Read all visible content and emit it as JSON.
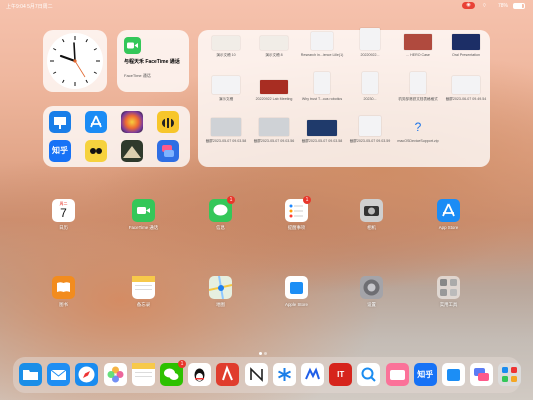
{
  "status": {
    "time_date": "上午9:04  5月7日周二",
    "battery": "78%",
    "battery_level": 0.78,
    "rec_color": "#e94235"
  },
  "facetime_widget": {
    "name": "与程天禾 FaceTime 通话",
    "subtitle": "FaceTime 通话"
  },
  "files_widget": {
    "items": [
      {
        "label": "演示文稿 10",
        "thumb": "#f1ede7"
      },
      {
        "label": "演示文稿 8",
        "thumb": "#f1ede7"
      },
      {
        "label": "Research in...ience Lille(1)",
        "thumb": "#f3f3f5"
      },
      {
        "label": "20220922...",
        "thumb": "#f3f3f5"
      },
      {
        "label": "... HERO Case",
        "thumb": "#b04a3e"
      },
      {
        "label": "Oral Presentation",
        "thumb": "#1c2e66"
      },
      {
        "label": "演示文稿",
        "thumb": "#f3f3f5"
      },
      {
        "label": "20220922 Lab Meeting",
        "thumb": "#a82d22"
      },
      {
        "label": "Why trust T...ous robotics",
        "thumb": "#f3f3f5"
      },
      {
        "label": "20230...",
        "thumb": "#f3f3f5"
      },
      {
        "label": "机务部港铁文档表格格式",
        "thumb": "#f3f3f5"
      },
      {
        "label": "截屏2023-06-07 09.49.54",
        "thumb": "#f3f3f5"
      },
      {
        "label": "截屏2023-05-07 09.03.58",
        "thumb": "#cfd2d6"
      },
      {
        "label": "截屏2023-05-07 09.03.56",
        "thumb": "#cfd2d6"
      },
      {
        "label": "截屏2023-05-07 09.03.58",
        "thumb": "#1f3a6b"
      },
      {
        "label": "截屏2023-05-07 09.03.59",
        "thumb": "#f3f3f5"
      },
      {
        "label": "macOSDeviceSupport.zip",
        "thumb": "#f3f3f5"
      }
    ]
  },
  "calendar": {
    "weekday": "周二",
    "day": "7"
  },
  "apps": [
    {
      "label": "日历",
      "icon": "calendar-icon"
    },
    {
      "label": "FaceTime 通话",
      "icon": "facetime-icon"
    },
    {
      "label": "信息",
      "icon": "messages-icon",
      "badge": "1"
    },
    {
      "label": "提醒事项",
      "icon": "reminders-icon",
      "badge": "1"
    },
    {
      "label": "相机",
      "icon": "camera-icon"
    },
    {
      "label": "App Store",
      "icon": "appstore-icon"
    },
    {
      "label": "图书",
      "icon": "books-icon"
    },
    {
      "label": "备忘录",
      "icon": "notes-icon"
    },
    {
      "label": "地图",
      "icon": "maps-icon"
    },
    {
      "label": "Apple Store",
      "icon": "apple-store-icon"
    },
    {
      "label": "设置",
      "icon": "settings-icon"
    },
    {
      "label": "实用工具",
      "icon": "utilities-folder-icon"
    }
  ],
  "smart_grid": [
    {
      "icon": "keynote-icon",
      "color": "#1a7ee8"
    },
    {
      "icon": "appstore-icon",
      "color": "#1b8cf5"
    },
    {
      "icon": "color-sphere-icon",
      "color": "#f07b2e"
    },
    {
      "icon": "bee-icon",
      "color": "#f7c62a"
    },
    {
      "icon": "zhihu-icon",
      "color": "#1772f6",
      "text": "知乎"
    },
    {
      "icon": "cartoon-icon",
      "color": "#f6d23e"
    },
    {
      "icon": "scenery-icon",
      "color": "#2f3a2c"
    },
    {
      "icon": "shortcuts-icon",
      "color": "#2f6fe4"
    }
  ],
  "dock": [
    {
      "icon": "files-icon",
      "color": "#1a8ee8"
    },
    {
      "icon": "mail-icon",
      "color": "#1f8ef3"
    },
    {
      "icon": "safari-icon",
      "color": "#1a8cf0"
    },
    {
      "icon": "photos-icon",
      "color": "#ffffff"
    },
    {
      "icon": "notes-icon",
      "color": "#ffffff"
    },
    {
      "icon": "wechat-icon",
      "color": "#2dc100",
      "badge": "1"
    },
    {
      "icon": "qq-icon",
      "color": "#ffffff"
    },
    {
      "icon": "red-app-icon",
      "color": "#e03d2d"
    },
    {
      "icon": "notion-icon",
      "color": "#ffffff"
    },
    {
      "icon": "asterisk-app-icon",
      "color": "#ffffff"
    },
    {
      "icon": "blue-m-app-icon",
      "color": "#ffffff"
    },
    {
      "icon": "ithome-icon",
      "color": "#d6241c",
      "text": "IT"
    },
    {
      "icon": "search-app-icon",
      "color": "#ffffff"
    },
    {
      "icon": "bilibili-icon",
      "color": "#fb7299"
    },
    {
      "icon": "zhihu-icon",
      "color": "#1772f6",
      "text": "知乎"
    },
    {
      "icon": "apple-store-icon",
      "color": "#ffffff"
    },
    {
      "icon": "shortcuts-icon",
      "color": "#ffffff"
    },
    {
      "icon": "app-library-icon",
      "color": "#dcdcdc"
    }
  ]
}
